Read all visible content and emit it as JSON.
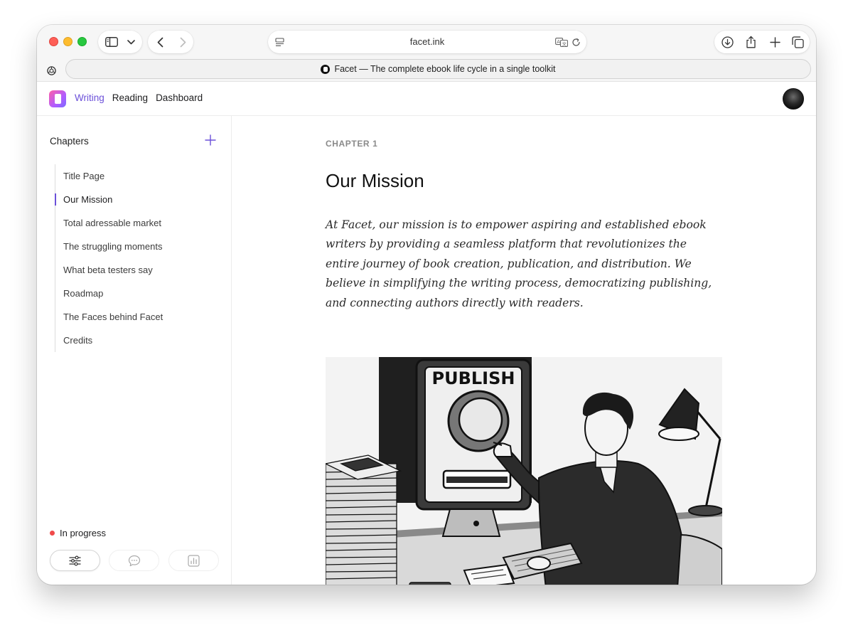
{
  "browser": {
    "url": "facet.ink",
    "tab_title": "Facet — The complete ebook life cycle in a single toolkit"
  },
  "app": {
    "nav": [
      {
        "label": "Writing",
        "active": true
      },
      {
        "label": "Reading",
        "active": false
      },
      {
        "label": "Dashboard",
        "active": false
      }
    ]
  },
  "sidebar": {
    "title": "Chapters",
    "items": [
      {
        "label": "Title Page"
      },
      {
        "label": "Our Mission"
      },
      {
        "label": "Total adressable market"
      },
      {
        "label": "The struggling moments"
      },
      {
        "label": "What beta testers say"
      },
      {
        "label": "Roadmap"
      },
      {
        "label": "The Faces behind Facet"
      },
      {
        "label": "Credits"
      }
    ],
    "active_index": 1,
    "status": {
      "label": "In progress",
      "color": "#f04a4a"
    }
  },
  "content": {
    "chapter_label": "CHAPTER 1",
    "title": "Our Mission",
    "body": "At Facet, our mission is to empower aspiring and established ebook writers by providing a seamless platform that revolutionizes the entire journey of book creation, publication, and distribution. We believe in simplifying the writing process, democratizing publishing, and connecting authors directly with readers.",
    "illustration": {
      "sign_text": "PUBLISH"
    }
  },
  "colors": {
    "accent": "#6b50d9",
    "status": "#f04a4a"
  },
  "icons": [
    "sidebar-toggle-icon",
    "chevron-down-icon",
    "back-icon",
    "forward-icon",
    "reader-icon",
    "translate-icon",
    "reload-icon",
    "download-icon",
    "share-icon",
    "plus-icon",
    "tabs-overview-icon",
    "openai-icon",
    "plus-icon",
    "sliders-icon",
    "comment-icon",
    "chart-icon"
  ]
}
